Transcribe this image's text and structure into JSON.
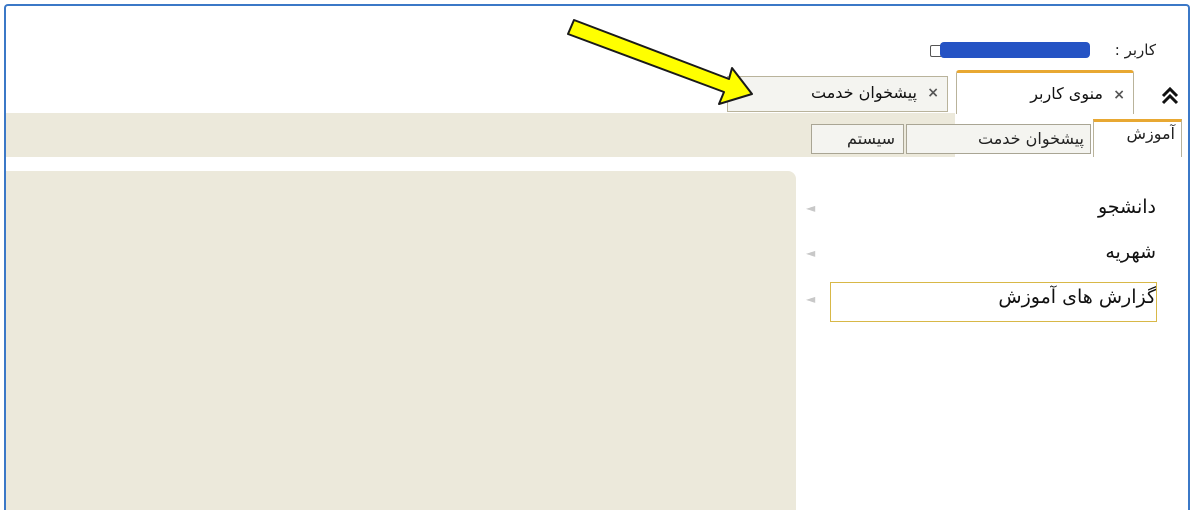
{
  "header": {
    "user_label": "کاربر :"
  },
  "tabs": [
    {
      "label": "منوی کاربر",
      "close": "×"
    },
    {
      "label": "پیشخوان خدمت",
      "close": "×"
    }
  ],
  "subtabs": [
    {
      "label": "آموزش"
    },
    {
      "label": "پیشخوان خدمت"
    },
    {
      "label": "سیستم"
    }
  ],
  "menu": {
    "items": [
      {
        "label": "دانشجو"
      },
      {
        "label": "شهریه"
      },
      {
        "label": "گزارش های آموزش"
      }
    ],
    "arrow": "◄"
  },
  "collapse_icon": "≈",
  "colors": {
    "accent": "#e8a832",
    "frame_border": "#3b78c7",
    "panel_bg": "#ece9db",
    "annotation_arrow": "#ffff00",
    "redaction": "#2553c4"
  }
}
